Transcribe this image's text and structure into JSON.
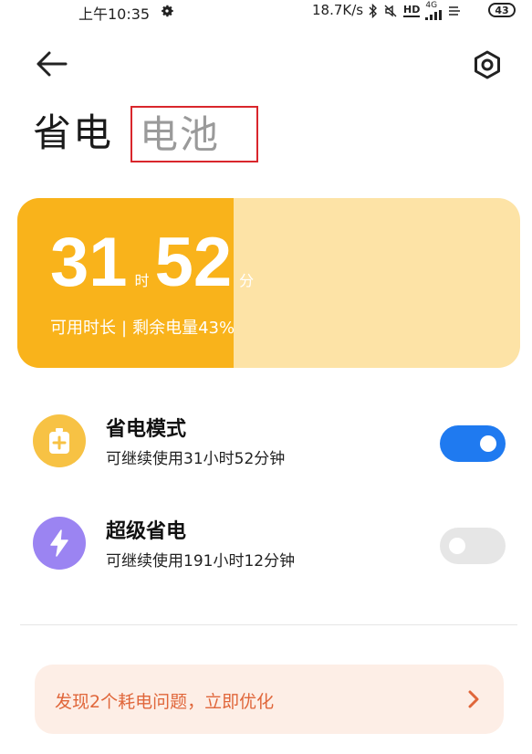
{
  "status_bar": {
    "time": "上午10:35",
    "network_speed": "18.7K/s",
    "hd_label": "HD",
    "network_type": "4G",
    "battery_level": "43"
  },
  "header": {
    "title": "省电",
    "tab_label": "电池"
  },
  "battery_card": {
    "hours": "31",
    "hours_unit": "时",
    "minutes": "52",
    "minutes_unit": "分",
    "subtitle_left": "可用时长",
    "subtitle_separator": "|",
    "subtitle_right": "剩余电量43%",
    "battery_percent": 43,
    "colors": {
      "fill": "#f9b31b",
      "track": "#fde3a6"
    }
  },
  "modes": [
    {
      "title": "省电模式",
      "subtitle": "可继续使用31小时52分钟",
      "enabled": true,
      "icon": "battery-plus-icon",
      "icon_color": "#f7c244"
    },
    {
      "title": "超级省电",
      "subtitle": "可继续使用191小时12分钟",
      "enabled": false,
      "icon": "lightning-icon",
      "icon_color": "#9b84f2"
    }
  ],
  "issue_banner": {
    "text": "发现2个耗电问题，立即优化",
    "icon": "chevron-right-icon",
    "color": "#e0663a"
  },
  "toggle_colors": {
    "on": "#1f7af0",
    "off": "#e6e6e6"
  }
}
